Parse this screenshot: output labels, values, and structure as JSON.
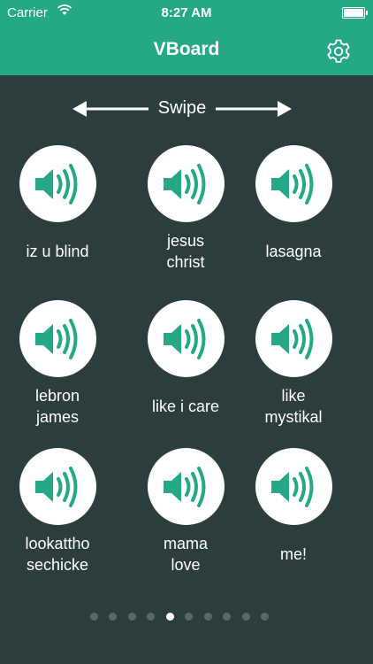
{
  "status_bar": {
    "carrier": "Carrier",
    "time": "8:27 AM"
  },
  "nav": {
    "title": "VBoard",
    "settings_icon": "gear-icon"
  },
  "swipe_hint": {
    "label": "Swipe"
  },
  "sounds": [
    {
      "label": "iz u blind"
    },
    {
      "label": "jesus\nchrist"
    },
    {
      "label": "lasagna"
    },
    {
      "label": "lebron\njames"
    },
    {
      "label": "like i care"
    },
    {
      "label": "like\nmystikal"
    },
    {
      "label": "lookattho\nsechicke"
    },
    {
      "label": "mama\nlove"
    },
    {
      "label": "me!"
    }
  ],
  "pager": {
    "total": 10,
    "current": 5
  },
  "colors": {
    "accent": "#25a886",
    "background": "#2b3d3c",
    "dot_inactive": "#59696a"
  }
}
